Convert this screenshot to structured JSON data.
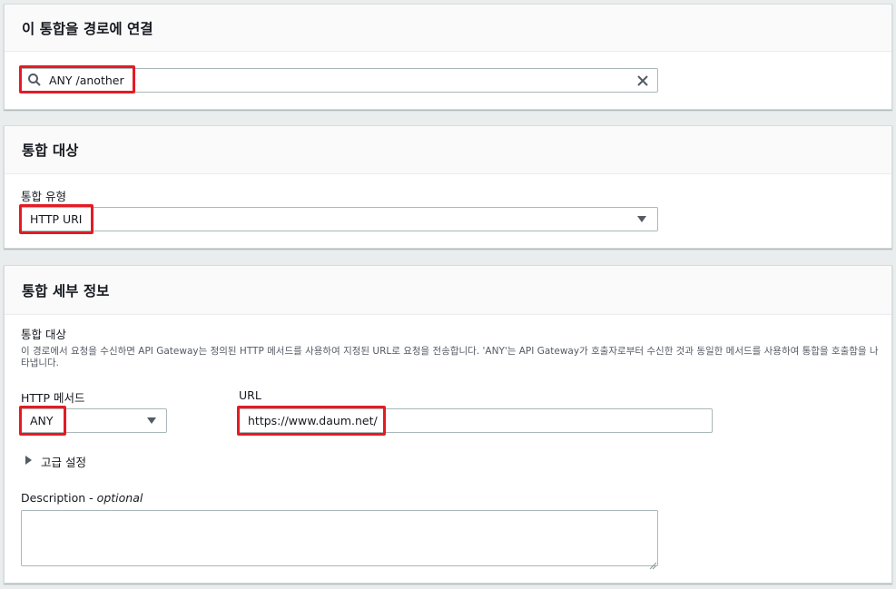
{
  "route_panel": {
    "title": "이 통합을 경로에 연결",
    "search_value": "ANY /another"
  },
  "target_panel": {
    "title": "통합 대상",
    "type_label": "통합 유형",
    "type_value": "HTTP URI"
  },
  "details_panel": {
    "title": "통합 세부 정보",
    "target_label": "통합 대상",
    "target_desc": "이 경로에서 요청을 수신하면 API Gateway는 정의된 HTTP 메서드를 사용하여 지정된 URL로 요청을 전송합니다. 'ANY'는 API Gateway가 호출자로부터 수신한 것과 동일한 메서드를 사용하여 통합을 호출함을 나타냅니다.",
    "method_label": "HTTP 메서드",
    "method_value": "ANY",
    "url_label": "URL",
    "url_value": "https://www.daum.net/",
    "advanced_label": "고급 설정",
    "description_label": "Description",
    "description_optional": "optional",
    "description_value": ""
  },
  "colors": {
    "highlight": "#e41b23",
    "border": "#aab7b8"
  }
}
